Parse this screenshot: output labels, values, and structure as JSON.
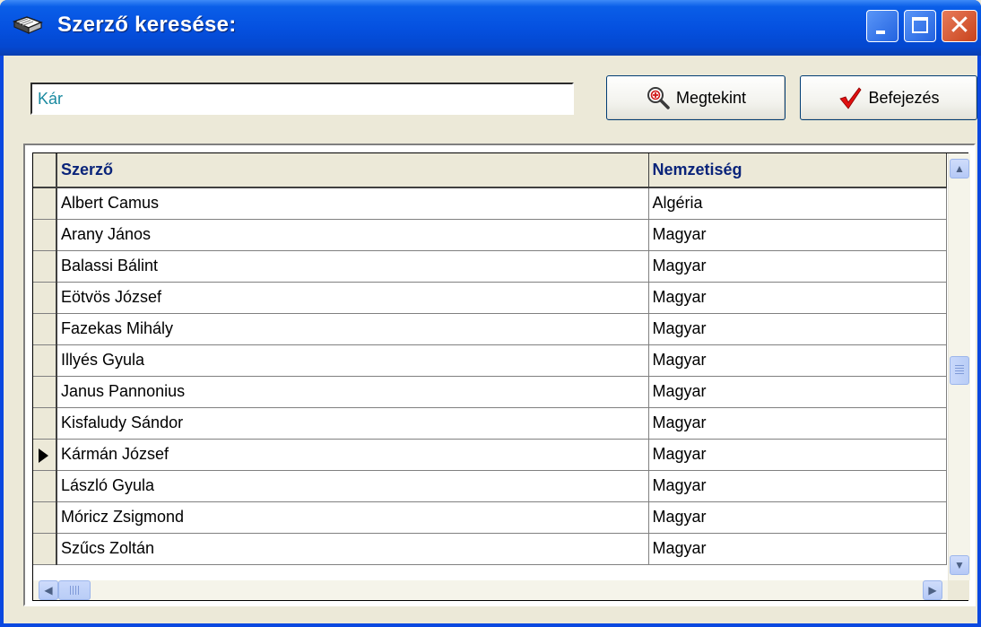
{
  "window": {
    "title": "Szerző keresése:",
    "icon": "book-icon",
    "colors": {
      "titlebar": "#0551e0",
      "face": "#ece9d8",
      "header_text": "#0a247a",
      "input_text": "#1a8aa0"
    }
  },
  "search": {
    "value": "Kár"
  },
  "buttons": {
    "view": {
      "label": "Megtekint",
      "icon": "magnifier-plus-icon"
    },
    "finish": {
      "label": "Befejezés",
      "icon": "red-checkmark-icon"
    }
  },
  "grid": {
    "columns": [
      "Szerző",
      "Nemzetiség"
    ],
    "current_row": 8,
    "rows": [
      {
        "author": "Albert Camus",
        "nationality": "Algéria"
      },
      {
        "author": "Arany János",
        "nationality": "Magyar"
      },
      {
        "author": "Balassi Bálint",
        "nationality": "Magyar"
      },
      {
        "author": "Eötvös József",
        "nationality": "Magyar"
      },
      {
        "author": "Fazekas Mihály",
        "nationality": "Magyar"
      },
      {
        "author": "Illyés Gyula",
        "nationality": "Magyar"
      },
      {
        "author": "Janus Pannonius",
        "nationality": "Magyar"
      },
      {
        "author": "Kisfaludy Sándor",
        "nationality": "Magyar"
      },
      {
        "author": "Kármán József",
        "nationality": "Magyar"
      },
      {
        "author": "László Gyula",
        "nationality": "Magyar"
      },
      {
        "author": "Móricz Zsigmond",
        "nationality": "Magyar"
      },
      {
        "author": "Szűcs Zoltán",
        "nationality": "Magyar"
      }
    ],
    "vertical_scroll_fraction": 0.5
  }
}
